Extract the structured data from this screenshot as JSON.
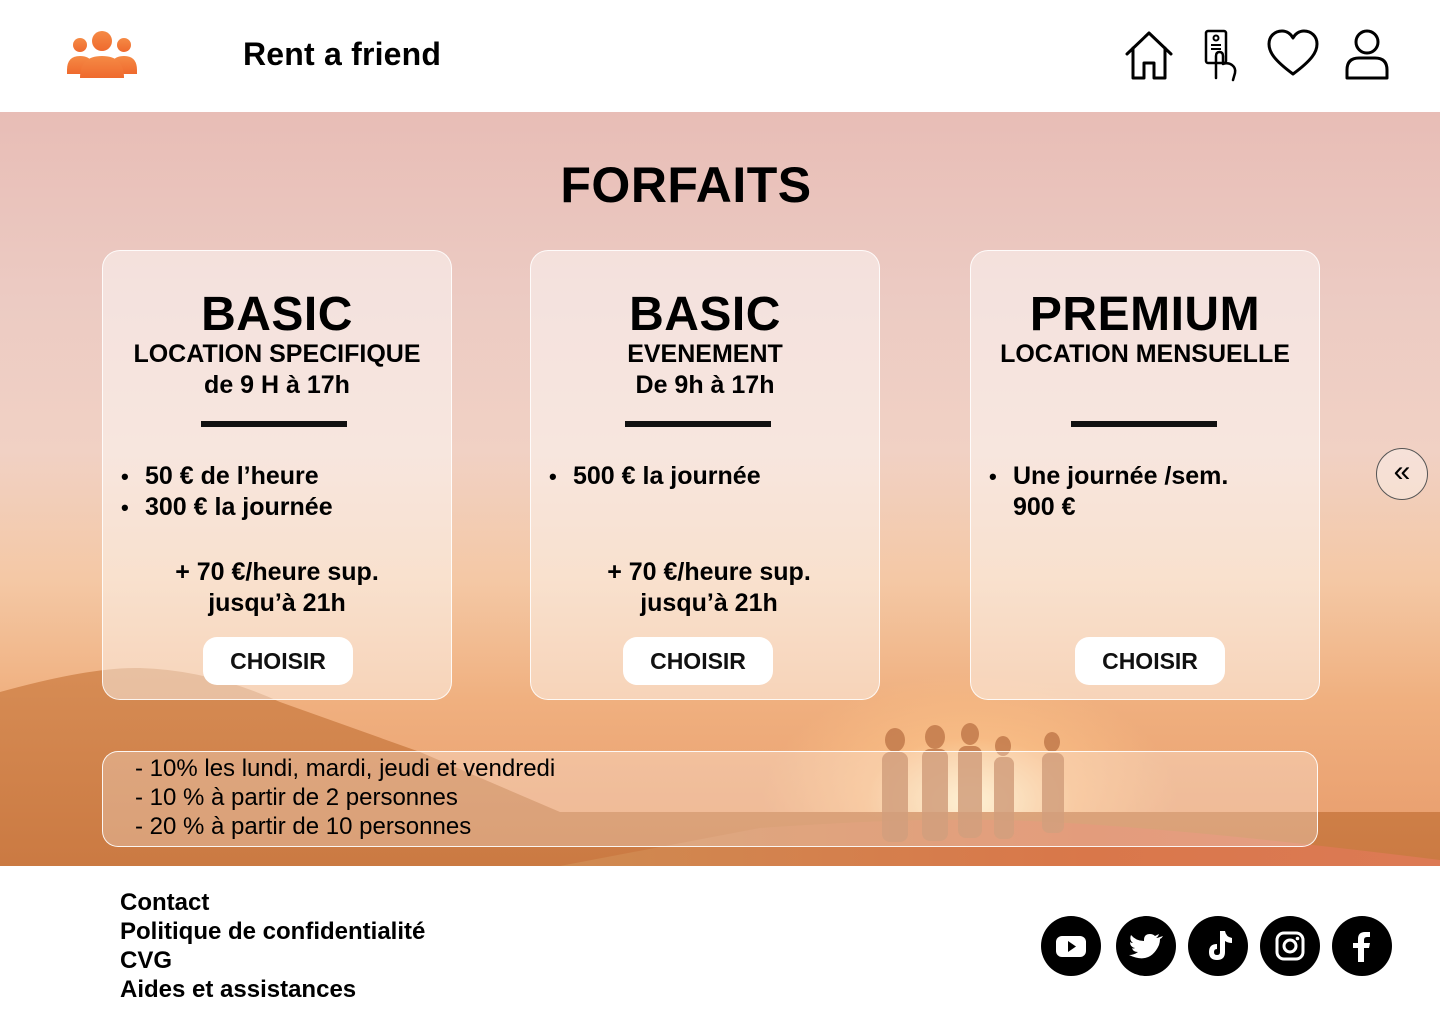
{
  "header": {
    "brand": "Rent a friend",
    "logo_icon": "group-people-icon",
    "logo_color": "#f07a3a",
    "nav_icons": [
      "home-icon",
      "id-card-tap-icon",
      "heart-icon",
      "user-icon"
    ]
  },
  "hero": {
    "title": "FORFAITS",
    "cards": [
      {
        "title": "BASIC",
        "subtitle_line1": "LOCATION SPECIFIQUE",
        "subtitle_line2": "de 9 H à 17h",
        "items": [
          "50 € de l’heure",
          " 300 € la journée"
        ],
        "extra_line1": "+ 70 €/heure sup.",
        "extra_line2": "jusqu’à 21h",
        "button": "CHOISIR"
      },
      {
        "title": "BASIC",
        "subtitle_line1": "EVENEMENT",
        "subtitle_line2": "De 9h à 17h",
        "items": [
          "500 € la journée"
        ],
        "extra_line1": "+ 70 €/heure sup.",
        "extra_line2": "jusqu’à 21h",
        "button": "CHOISIR"
      },
      {
        "title": "PREMIUM",
        "subtitle_line1": "LOCATION MENSUELLE",
        "subtitle_line2": "",
        "items": [
          "Une journée /sem."
        ],
        "item_continuation": "900 €",
        "extra_line1": "",
        "extra_line2": "",
        "button": "CHOISIR"
      }
    ],
    "side_button": "«",
    "discounts": [
      "- 10% les lundi, mardi, jeudi et vendredi",
      "- 10 % à partir de 2 personnes",
      "- 20 % à partir de 10 personnes"
    ]
  },
  "footer": {
    "links": [
      "Contact",
      "Politique de confidentialité",
      "CVG",
      "Aides et assistances"
    ],
    "socials": [
      "youtube-icon",
      "twitter-icon",
      "tiktok-icon",
      "instagram-icon",
      "facebook-icon"
    ]
  }
}
